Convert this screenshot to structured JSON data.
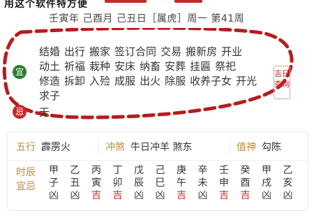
{
  "banner": {
    "caption": "用这个软件特方便"
  },
  "date_line": "壬寅年 己酉月 己丑日［属虎］周一  第41周",
  "yi": {
    "badge": "宜",
    "items": [
      "结婚",
      "出行",
      "搬家",
      "签订合同",
      "交易",
      "搬新房",
      "开业",
      "动土",
      "祈福",
      "栽种",
      "安床",
      "纳畜",
      "安葬",
      "挂匾",
      "祭祀",
      "修造",
      "拆卸",
      "入殓",
      "成服",
      "出火",
      "除服",
      "收养子女",
      "开光",
      "求子"
    ]
  },
  "ji": {
    "badge": "忌",
    "items": "无"
  },
  "query_button": "吉日查询",
  "info": {
    "wuxing_label": "五行",
    "wuxing_value": "霹雳火",
    "chongsha_label": "冲煞",
    "chongsha_value": "牛日冲羊 煞东",
    "zhishen_label": "值神",
    "zhishen_value": "勾陈"
  },
  "hours": {
    "label": "时辰宜忌",
    "cols": [
      {
        "g": "甲",
        "z": "子",
        "s": "凶"
      },
      {
        "g": "乙",
        "z": "丑",
        "s": "凶"
      },
      {
        "g": "丙",
        "z": "寅",
        "s": "吉"
      },
      {
        "g": "丁",
        "z": "卯",
        "s": "吉"
      },
      {
        "g": "戊",
        "z": "辰",
        "s": "凶"
      },
      {
        "g": "己",
        "z": "巳",
        "s": "凶"
      },
      {
        "g": "庚",
        "z": "午",
        "s": "吉"
      },
      {
        "g": "辛",
        "z": "未",
        "s": "凶"
      },
      {
        "g": "壬",
        "z": "申",
        "s": "吉"
      },
      {
        "g": "癸",
        "z": "酉",
        "s": "吉"
      },
      {
        "g": "甲",
        "z": "戌",
        "s": "凶"
      },
      {
        "g": "乙",
        "z": "亥",
        "s": "凶"
      }
    ]
  },
  "colors": {
    "accent_red": "#c62828",
    "good_green": "#2e7d32",
    "label_gold": "#c08a3a"
  }
}
